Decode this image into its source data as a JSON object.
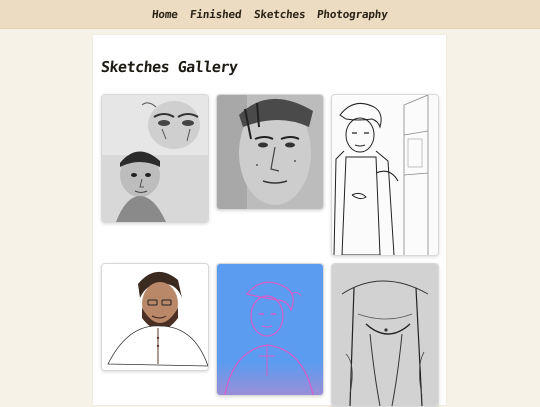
{
  "nav": {
    "items": [
      {
        "label": "Home"
      },
      {
        "label": "Finished"
      },
      {
        "label": "Sketches"
      },
      {
        "label": "Photography"
      }
    ]
  },
  "gallery": {
    "title": "Sketches Gallery",
    "images": [
      {
        "subject": "sketch-faces-pencil"
      },
      {
        "subject": "sketch-man-portrait-pencil"
      },
      {
        "subject": "sketch-man-lineart-doorway"
      },
      {
        "subject": "sketch-bearded-man-colored"
      },
      {
        "subject": "sketch-man-blue-pink"
      },
      {
        "subject": "sketch-legs-pencil"
      }
    ]
  },
  "colors": {
    "topbar": "#ecdcc1",
    "page_bg": "#f7f2e7",
    "panel_bg": "#ffffff",
    "sketch_blue": "#5b9cf0",
    "sketch_pink": "#d85cc8"
  }
}
